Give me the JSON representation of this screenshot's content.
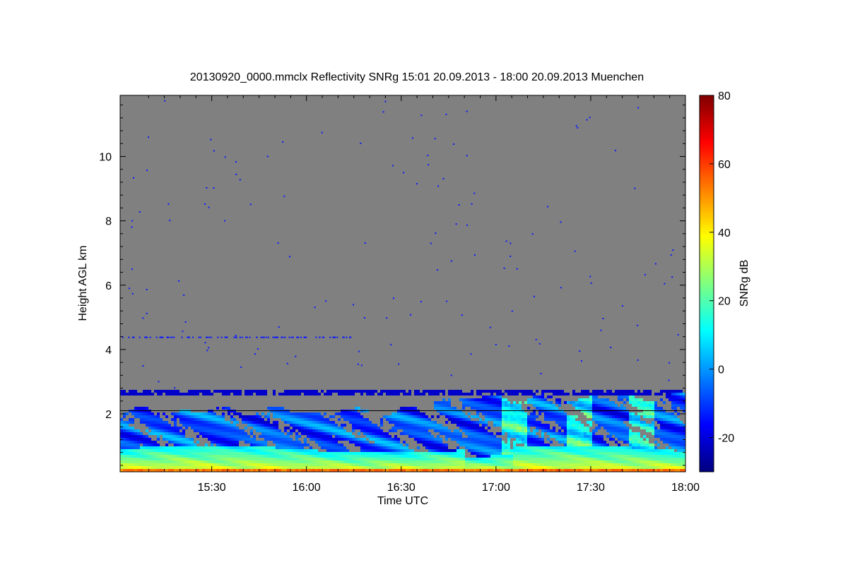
{
  "chart_data": {
    "type": "heatmap",
    "title": "20130920_0000.mmclx Reflectivity SNRg   15:01 20.09.2013 - 18:00 20.09.2013 Muenchen",
    "xlabel": "Time UTC",
    "ylabel": "Height AGL km",
    "x_ticks": [
      "15:30",
      "16:00",
      "16:30",
      "17:00",
      "17:30",
      "18:00"
    ],
    "x_tick_minutes": [
      30,
      60,
      90,
      120,
      150,
      180
    ],
    "xlim_minutes_after_1500": [
      1,
      180
    ],
    "y_ticks": [
      2,
      4,
      6,
      8,
      10
    ],
    "ylim": [
      0.2,
      11.9
    ],
    "colorbar": {
      "label": "SNRg dB",
      "ticks": [
        -20,
        0,
        20,
        40,
        60,
        80
      ],
      "range": [
        -30,
        80
      ],
      "colormap": "jet"
    },
    "background_color": "#808080",
    "reference_line": {
      "height_km": 2.1,
      "color": "#000000"
    },
    "features": {
      "surface_layer_top_km": 0.9,
      "blue_speckle_band_km": 2.65,
      "upper_speckle_band_km": 4.4,
      "cloud_layer_km": [
        1.0,
        2.5
      ]
    }
  }
}
